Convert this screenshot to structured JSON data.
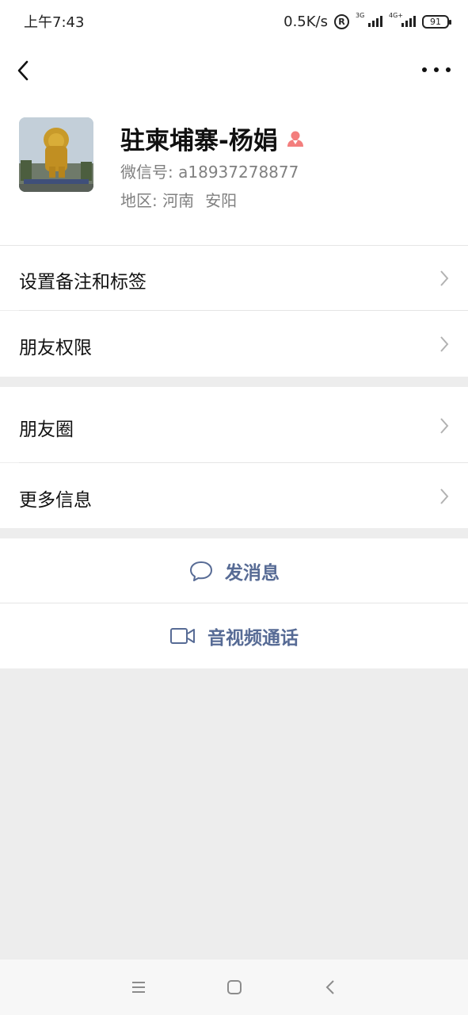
{
  "status_bar": {
    "time": "上午7:43",
    "speed": "0.5K/s",
    "reg": "R",
    "net1": "3G",
    "net2": "4G+",
    "battery": "91"
  },
  "profile": {
    "name": "驻柬埔寨-杨娟",
    "wechat_id_label": "微信号:",
    "wechat_id": "a18937278877",
    "region_label": "地区:",
    "province": "河南",
    "city": "安阳",
    "avatar_icon": "lion-statue-photo",
    "gender_icon": "female-icon"
  },
  "menu": {
    "remark_tags": "设置备注和标签",
    "friend_permissions": "朋友权限",
    "moments": "朋友圈",
    "more_info": "更多信息"
  },
  "actions": {
    "send_message": "发消息",
    "video_call": "音视频通话"
  },
  "colors": {
    "link": "#576b95",
    "female": "#f37e7d",
    "background": "#ededed"
  }
}
